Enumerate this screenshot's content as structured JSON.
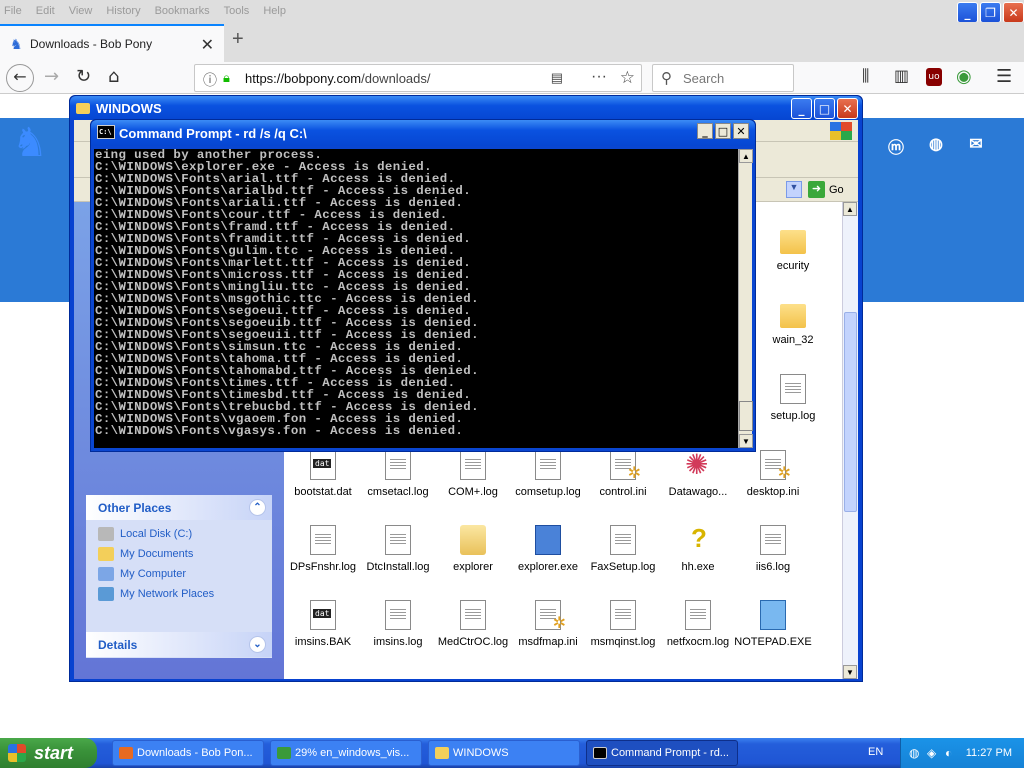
{
  "firefox": {
    "menu": [
      "File",
      "Edit",
      "View",
      "History",
      "Bookmarks",
      "Tools",
      "Help"
    ],
    "tab_title": "Downloads - Bob Pony",
    "url_domain": "https://bobpony.com",
    "url_path": "/downloads/",
    "search_placeholder": "Search"
  },
  "explorer": {
    "title": "WINDOWS",
    "go_label": "Go",
    "other_places": {
      "header": "Other Places",
      "items": [
        "Local Disk (C:)",
        "My Documents",
        "My Computer",
        "My Network Places"
      ]
    },
    "details_header": "Details",
    "partial_labels": [
      "ecurity",
      "wain_32",
      "setup.log"
    ],
    "files": [
      {
        "name": "bootstat.dat",
        "icon": "dat"
      },
      {
        "name": "cmsetacl.log",
        "icon": "txt"
      },
      {
        "name": "COM+.log",
        "icon": "txt"
      },
      {
        "name": "comsetup.log",
        "icon": "txt"
      },
      {
        "name": "control.ini",
        "icon": "gear"
      },
      {
        "name": "Datawago...",
        "icon": "star"
      },
      {
        "name": "desktop.ini",
        "icon": "gear"
      },
      {
        "name": "DPsFnshr.log",
        "icon": "txt"
      },
      {
        "name": "DtcInstall.log",
        "icon": "txt"
      },
      {
        "name": "explorer",
        "icon": "explorer"
      },
      {
        "name": "explorer.exe",
        "icon": "exe"
      },
      {
        "name": "FaxSetup.log",
        "icon": "txt"
      },
      {
        "name": "hh.exe",
        "icon": "help"
      },
      {
        "name": "iis6.log",
        "icon": "txt"
      },
      {
        "name": "imsins.BAK",
        "icon": "dat"
      },
      {
        "name": "imsins.log",
        "icon": "txt"
      },
      {
        "name": "MedCtrOC.log",
        "icon": "txt"
      },
      {
        "name": "msdfmap.ini",
        "icon": "gear"
      },
      {
        "name": "msmqinst.log",
        "icon": "txt"
      },
      {
        "name": "netfxocm.log",
        "icon": "txt"
      },
      {
        "name": "NOTEPAD.EXE",
        "icon": "note"
      }
    ]
  },
  "cmd": {
    "title": "Command Prompt - rd /s /q C:\\",
    "lines": [
      "eing used by another process.",
      "C:\\WINDOWS\\explorer.exe - Access is denied.",
      "C:\\WINDOWS\\Fonts\\arial.ttf - Access is denied.",
      "C:\\WINDOWS\\Fonts\\arialbd.ttf - Access is denied.",
      "C:\\WINDOWS\\Fonts\\ariali.ttf - Access is denied.",
      "C:\\WINDOWS\\Fonts\\cour.ttf - Access is denied.",
      "C:\\WINDOWS\\Fonts\\framd.ttf - Access is denied.",
      "C:\\WINDOWS\\Fonts\\framdit.ttf - Access is denied.",
      "C:\\WINDOWS\\Fonts\\gulim.ttc - Access is denied.",
      "C:\\WINDOWS\\Fonts\\marlett.ttf - Access is denied.",
      "C:\\WINDOWS\\Fonts\\micross.ttf - Access is denied.",
      "C:\\WINDOWS\\Fonts\\mingliu.ttc - Access is denied.",
      "C:\\WINDOWS\\Fonts\\msgothic.ttc - Access is denied.",
      "C:\\WINDOWS\\Fonts\\segoeui.ttf - Access is denied.",
      "C:\\WINDOWS\\Fonts\\segoeuib.ttf - Access is denied.",
      "C:\\WINDOWS\\Fonts\\segoeuii.ttf - Access is denied.",
      "C:\\WINDOWS\\Fonts\\simsun.ttc - Access is denied.",
      "C:\\WINDOWS\\Fonts\\tahoma.ttf - Access is denied.",
      "C:\\WINDOWS\\Fonts\\tahomabd.ttf - Access is denied.",
      "C:\\WINDOWS\\Fonts\\times.ttf - Access is denied.",
      "C:\\WINDOWS\\Fonts\\timesbd.ttf - Access is denied.",
      "C:\\WINDOWS\\Fonts\\trebucbd.ttf - Access is denied.",
      "C:\\WINDOWS\\Fonts\\vgaoem.fon - Access is denied.",
      "C:\\WINDOWS\\Fonts\\vgasys.fon - Access is denied."
    ]
  },
  "taskbar": {
    "start_label": "start",
    "tasks": [
      "Downloads - Bob Pon...",
      "29% en_windows_vis...",
      "WINDOWS",
      "Command Prompt - rd..."
    ],
    "language": "EN",
    "clock": "11:27 PM"
  }
}
